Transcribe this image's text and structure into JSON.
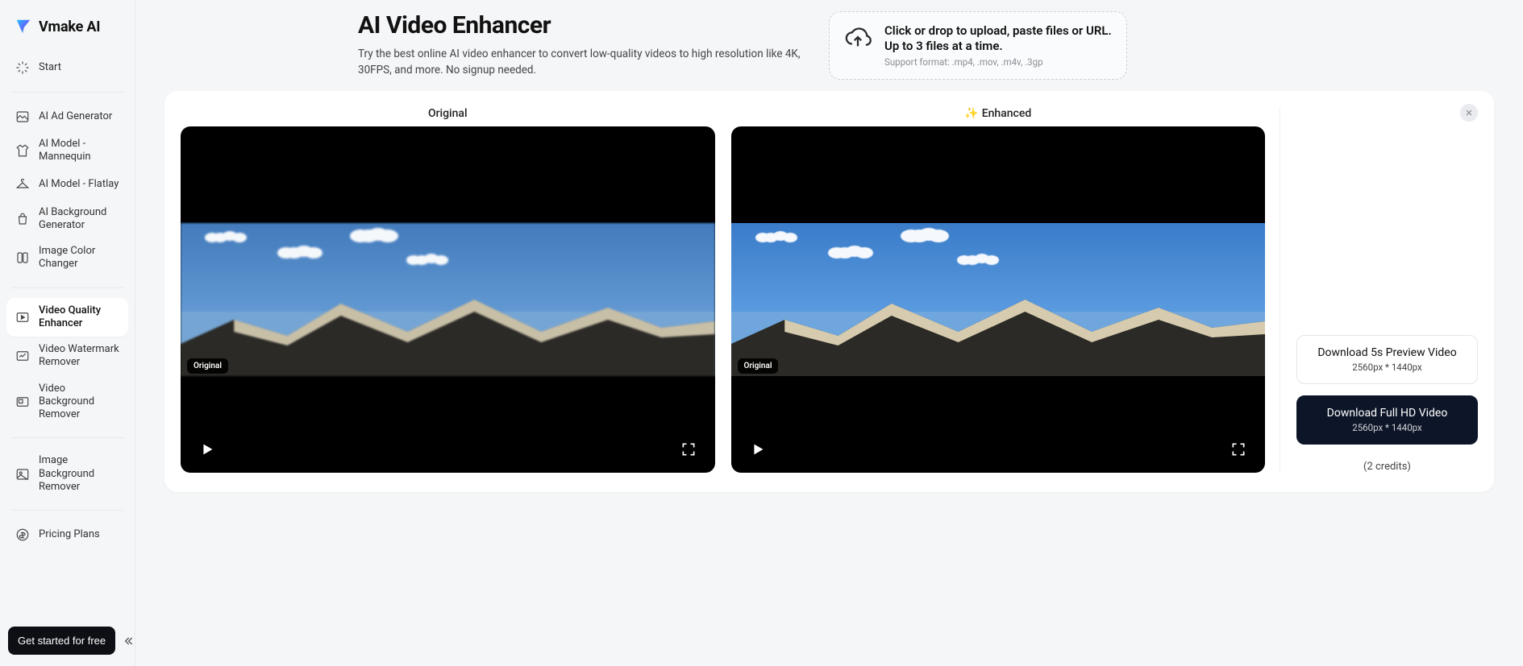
{
  "brand": {
    "name": "Vmake AI"
  },
  "sidebar": {
    "start": "Start",
    "items": [
      {
        "label": "AI Ad Generator"
      },
      {
        "label": "AI Model - Mannequin"
      },
      {
        "label": "AI Model - Flatlay"
      },
      {
        "label": "AI Background Generator"
      },
      {
        "label": "Image Color Changer"
      }
    ],
    "videoItems": [
      {
        "label": "Video Quality Enhancer",
        "active": true
      },
      {
        "label": "Video Watermark Remover"
      },
      {
        "label": "Video Background Remover"
      }
    ],
    "imageItems": [
      {
        "label": "Image Background Remover"
      }
    ],
    "pricing": "Pricing Plans",
    "cta": "Get started for free"
  },
  "header": {
    "title": "AI Video Enhancer",
    "subtitle": "Try the best online AI video enhancer to convert low-quality videos to high resolution like 4K, 30FPS, and more. No signup needed."
  },
  "upload": {
    "line1": "Click or drop to upload, paste files or URL.",
    "line2": "Up to 3 files at a time.",
    "formats": "Support format: .mp4, .mov, .m4v, .3gp"
  },
  "videos": {
    "originalLabel": "Original",
    "enhancedLabel": "Enhanced",
    "badgeOriginal": "Original",
    "badgeEnhanced": "Original"
  },
  "download": {
    "preview": "Download 5s Preview Video",
    "previewRes": "2560px * 1440px",
    "full": "Download Full HD Video",
    "fullRes": "2560px * 1440px",
    "credits": "(2 credits)"
  }
}
